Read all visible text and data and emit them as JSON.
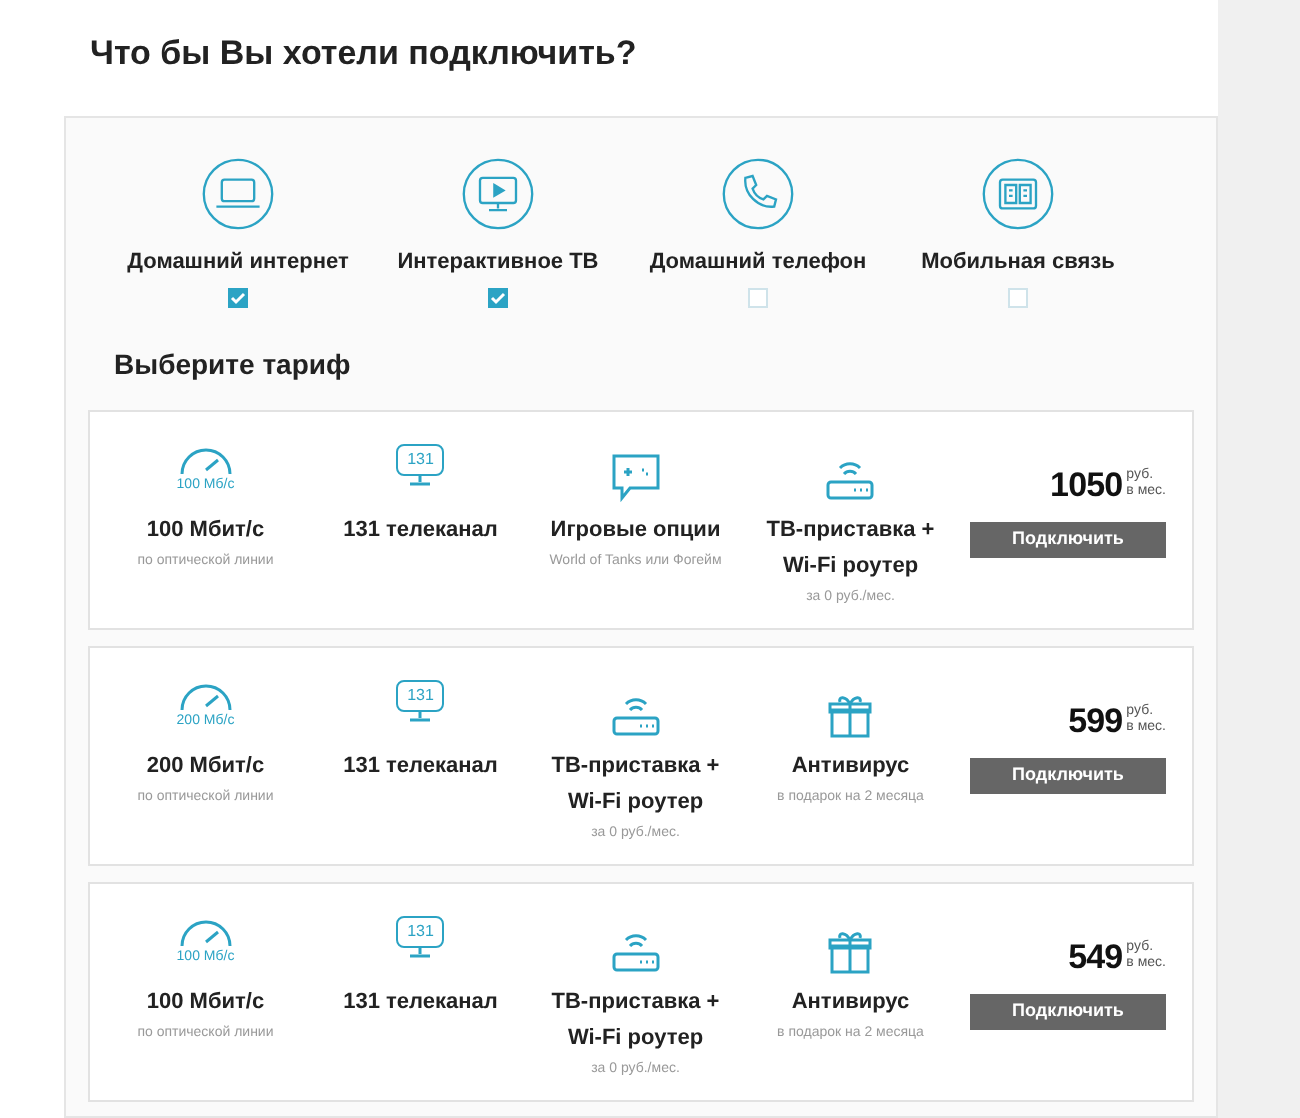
{
  "title": "Что бы Вы хотели подключить?",
  "services": [
    {
      "kind": "laptop",
      "label": "Домашний интернет",
      "checked": true
    },
    {
      "kind": "tv",
      "label": "Интерактивное ТВ",
      "checked": true
    },
    {
      "kind": "phone",
      "label": "Домашний телефон",
      "checked": false
    },
    {
      "kind": "sim",
      "label": "Мобильная связь",
      "checked": false
    }
  ],
  "tariff_heading": "Выберите тариф",
  "tariffs": [
    {
      "features": [
        {
          "kind": "speed",
          "icon_text": "100 Мб/с",
          "title": "100 Мбит/с",
          "note": "по оптической линии"
        },
        {
          "kind": "channels",
          "icon_text": "131",
          "title": "131 телеканал"
        },
        {
          "kind": "game",
          "title": "Игровые опции",
          "note": "World of Tanks или Фогейм"
        },
        {
          "kind": "router",
          "title": "ТВ-приставка + Wi-Fi роутер",
          "note": "за 0 руб./мес."
        }
      ],
      "price": "1050",
      "currency": "руб.",
      "period": "в мес.",
      "button": "Подключить"
    },
    {
      "features": [
        {
          "kind": "speed",
          "icon_text": "200 Мб/с",
          "title": "200 Мбит/с",
          "note": "по оптической линии"
        },
        {
          "kind": "channels",
          "icon_text": "131",
          "title": "131 телеканал"
        },
        {
          "kind": "router",
          "title": "ТВ-приставка + Wi-Fi роутер",
          "note": "за 0 руб./мес."
        },
        {
          "kind": "gift",
          "title": "Антивирус",
          "note": "в подарок на 2 месяца"
        }
      ],
      "price": "599",
      "currency": "руб.",
      "period": "в мес.",
      "button": "Подключить"
    },
    {
      "features": [
        {
          "kind": "speed",
          "icon_text": "100 Мб/с",
          "title": "100 Мбит/с",
          "note": "по оптической линии"
        },
        {
          "kind": "channels",
          "icon_text": "131",
          "title": "131 телеканал"
        },
        {
          "kind": "router",
          "title": "ТВ-приставка + Wi-Fi роутер",
          "note": "за 0 руб./мес."
        },
        {
          "kind": "gift",
          "title": "Антивирус",
          "note": "в подарок на 2 месяца"
        }
      ],
      "price": "549",
      "currency": "руб.",
      "period": "в мес.",
      "button": "Подключить"
    }
  ]
}
